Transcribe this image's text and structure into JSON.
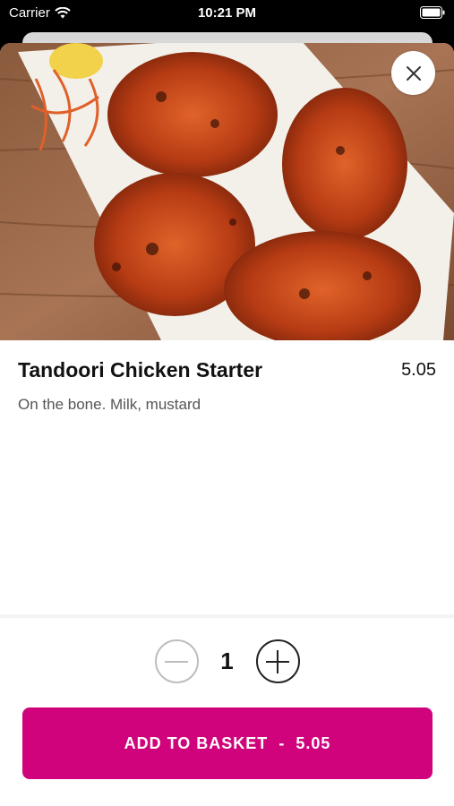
{
  "status_bar": {
    "carrier": "Carrier",
    "time": "10:21 PM"
  },
  "item": {
    "title": "Tandoori Chicken Starter",
    "price": "5.05",
    "description": "On the bone. Milk, mustard"
  },
  "quantity": {
    "value": "1"
  },
  "add_button": {
    "label": "ADD TO BASKET",
    "separator": "-",
    "price": "5.05"
  },
  "colors": {
    "accent": "#d0037c"
  },
  "icons": {
    "close": "close-icon",
    "minus": "minus-icon",
    "plus": "plus-icon",
    "wifi": "wifi-icon",
    "battery": "battery-icon"
  }
}
